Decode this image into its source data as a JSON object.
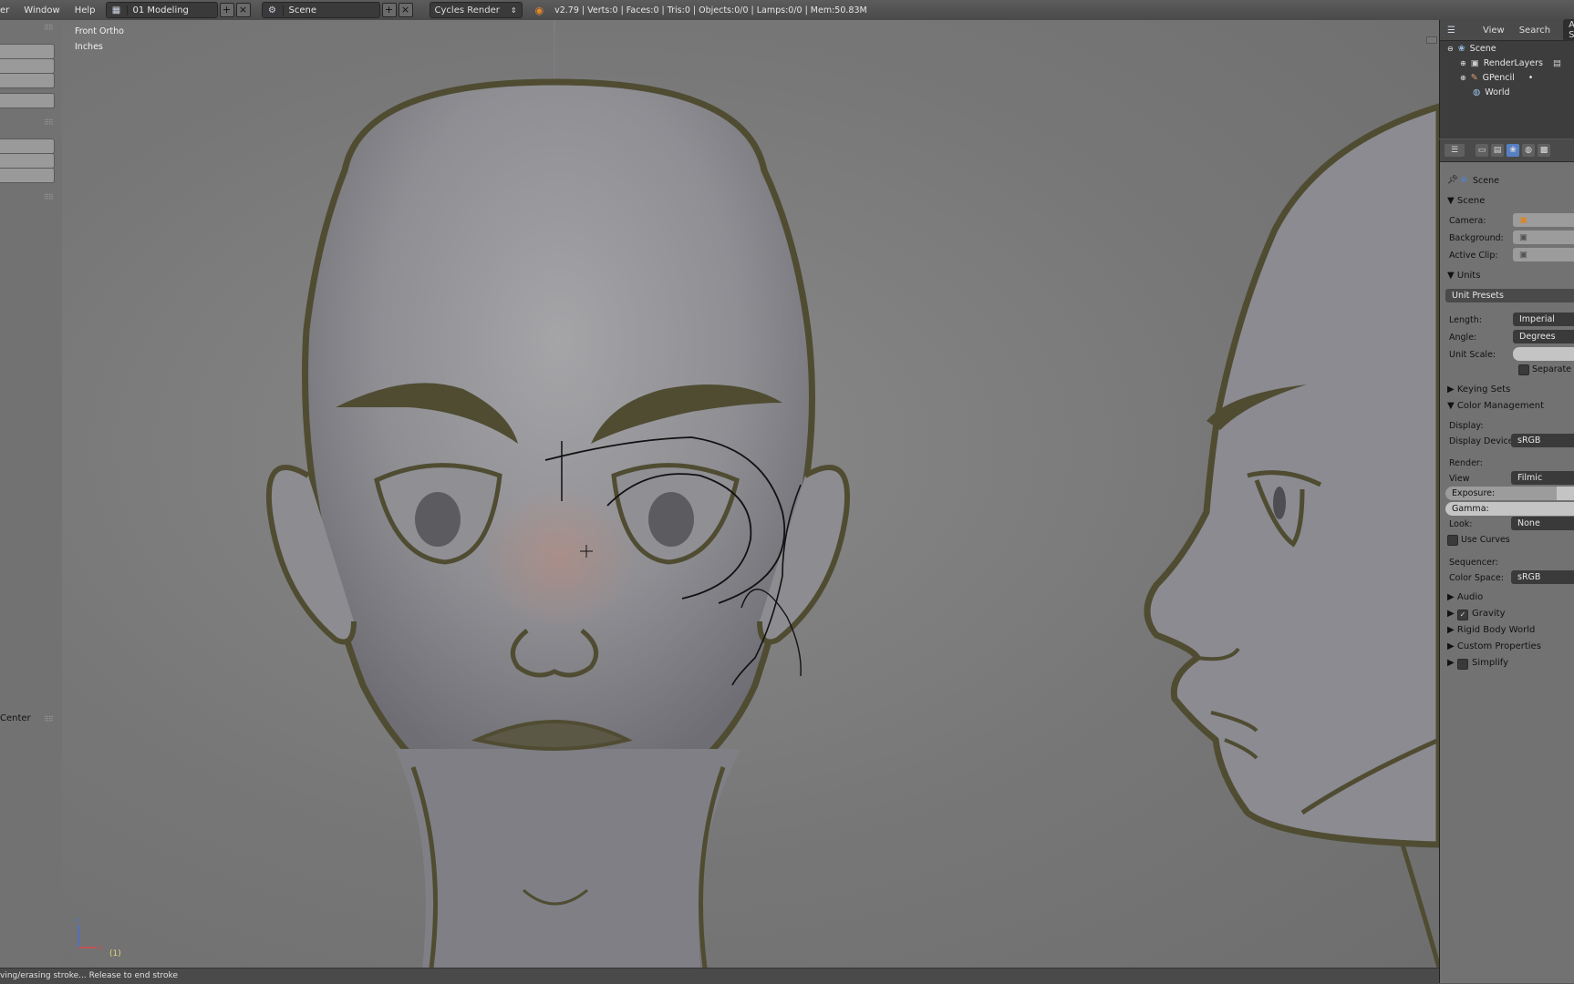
{
  "topbar": {
    "menus": [
      "er",
      "Window",
      "Help"
    ],
    "screen_layout": "01 Modeling",
    "scene": "Scene",
    "render_engine": "Cycles Render",
    "stats": "v2.79 | Verts:0 | Faces:0 | Tris:0 | Objects:0/0 | Lamps:0/0 | Mem:50.83M"
  },
  "toolshelf": {
    "panel_label": "Center"
  },
  "viewport": {
    "view_name": "Front Ortho",
    "units": "Inches",
    "frame": "(1)"
  },
  "status": {
    "text": "ving/erasing stroke... Release to end stroke"
  },
  "outliner": {
    "header": {
      "view": "View",
      "search": "Search",
      "filter": "All Sc"
    },
    "items": [
      {
        "label": "Scene",
        "icon": "scene-icon"
      },
      {
        "label": "RenderLayers",
        "icon": "render-layers-icon"
      },
      {
        "label": "GPencil",
        "icon": "grease-pencil-icon"
      },
      {
        "label": "World",
        "icon": "world-icon"
      }
    ]
  },
  "properties": {
    "context": "Scene",
    "scene_section": "Scene",
    "camera_label": "Camera:",
    "background_label": "Background:",
    "active_clip_label": "Active Clip:",
    "units_section": "Units",
    "unit_presets": "Unit Presets",
    "length_label": "Length:",
    "length_value": "Imperial",
    "angle_label": "Angle:",
    "angle_value": "Degrees",
    "unit_scale_label": "Unit Scale:",
    "separate_label": "Separate",
    "keying_sets": "Keying Sets",
    "color_management": "Color Management",
    "display_label": "Display:",
    "display_device_label": "Display Device:",
    "display_device_value": "sRGB",
    "render_label": "Render:",
    "view_label": "View",
    "view_value": "Filmic",
    "exposure_label": "Exposure:",
    "gamma_label": "Gamma:",
    "look_label": "Look:",
    "look_value": "None",
    "use_curves": "Use Curves",
    "sequencer_label": "Sequencer:",
    "color_space_label": "Color Space:",
    "color_space_value": "sRGB",
    "audio": "Audio",
    "gravity": "Gravity",
    "rigid_body_world": "Rigid Body World",
    "custom_properties": "Custom Properties",
    "simplify": "Simplify"
  }
}
